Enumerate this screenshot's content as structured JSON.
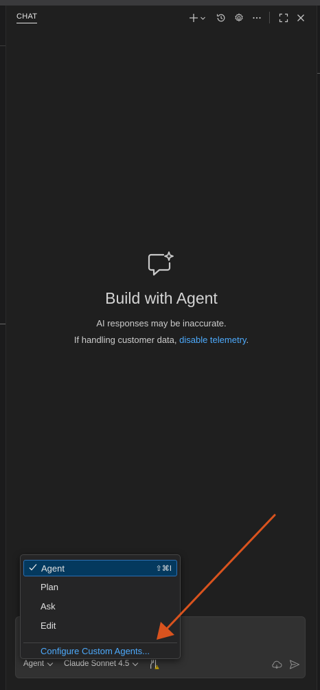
{
  "header": {
    "tab_label": "CHAT",
    "icons": [
      "plus-icon",
      "chevron-down-icon",
      "history-icon",
      "gear-icon",
      "more-icon",
      "maximize-icon",
      "close-icon"
    ]
  },
  "welcome": {
    "icon": "chat-sparkle-icon",
    "title": "Build with Agent",
    "disclaimer": "AI responses may be inaccurate.",
    "telemetry_prefix": "If handling customer data, ",
    "telemetry_link": "disable telemetry",
    "telemetry_suffix": "."
  },
  "menu": {
    "items": [
      {
        "label": "Agent",
        "selected": true,
        "shortcut": "⇧⌘I"
      },
      {
        "label": "Plan",
        "selected": false
      },
      {
        "label": "Ask",
        "selected": false
      },
      {
        "label": "Edit",
        "selected": false
      }
    ],
    "configure_label": "Configure Custom Agents..."
  },
  "input": {
    "mode_label": "Agent",
    "model_label": "Claude Sonnet 4.5",
    "icons": [
      "tools-icon",
      "warning-icon",
      "delegate-cloud-icon",
      "send-icon"
    ]
  },
  "colors": {
    "background": "#1f1f1f",
    "accent_link": "#4daafc",
    "selection": "#04395e",
    "annotation_arrow": "#d9531e",
    "warning": "#cca700"
  }
}
